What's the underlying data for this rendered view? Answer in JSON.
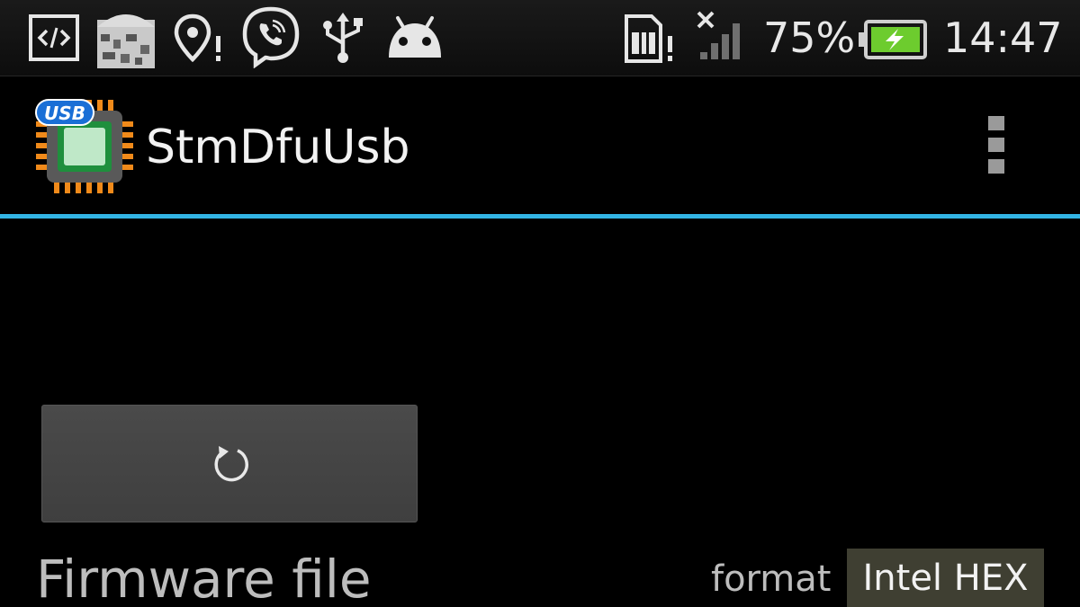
{
  "status_bar": {
    "notification_icons": [
      "developer-code-icon",
      "app-thumbnail-icon",
      "location-alert-icon",
      "viber-icon",
      "usb-icon",
      "android-debug-icon"
    ],
    "system_icons": [
      "sim-card-alert-icon",
      "no-signal-icon",
      "battery-charging-icon"
    ],
    "battery_percent": "75%",
    "time": "14:47",
    "battery_fill_color": "#6dcc2e"
  },
  "action_bar": {
    "app_icon": "usb-chip-icon",
    "icon_badge": "USB",
    "title": "StmDfuUsb",
    "accent_color": "#33b5e5"
  },
  "content": {
    "reload_icon": "reload-icon",
    "firmware_label": "Firmware file",
    "format_label": "format",
    "format_value": "Intel HEX"
  }
}
